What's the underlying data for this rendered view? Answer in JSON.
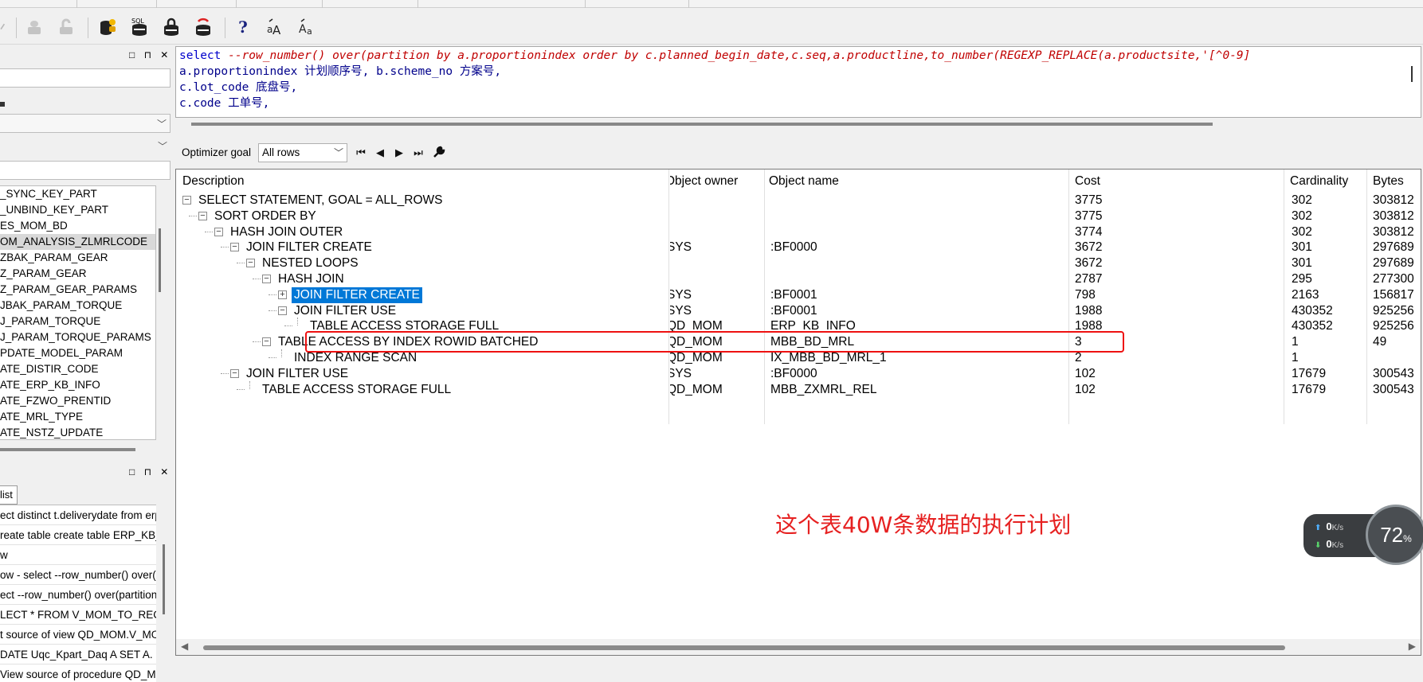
{
  "toolbar": {
    "icons": [
      "disabled-icon",
      "lock-icon",
      "unlock-icon",
      "database-user-icon",
      "sql-database-icon",
      "lock-db-icon",
      "refresh-db-icon",
      "help-icon",
      "font-increase-icon",
      "font-decrease-icon"
    ],
    "help_label": "?"
  },
  "left_panel": {
    "controls": "□ ⊓ ✕",
    "objects": [
      "_SYNC_KEY_PART",
      "_UNBIND_KEY_PART",
      "ES_MOM_BD",
      "OM_ANALYSIS_ZLMRLCODE",
      "ZBAK_PARAM_GEAR",
      "Z_PARAM_GEAR",
      "Z_PARAM_GEAR_PARAMS",
      "JBAK_PARAM_TORQUE",
      "J_PARAM_TORQUE",
      "J_PARAM_TORQUE_PARAMS",
      "PDATE_MODEL_PARAM",
      "ATE_DISTIR_CODE",
      "ATE_ERP_KB_INFO",
      "ATE_FZWO_PRENTID",
      "ATE_MRL_TYPE",
      "ATE_NSTZ_UPDATE"
    ],
    "selected_index": 3
  },
  "history_panel": {
    "controls": "□ ⊓ ✕",
    "tab_label": "list",
    "items": [
      "ect distinct t.deliverydate from erp",
      "reate table create table ERP_KB_",
      "w",
      "ow - select --row_number() over(p",
      "ect --row_number() over(partition b",
      "LECT * FROM V_MOM_TO_REC",
      "t source of view QD_MOM.V_MO",
      "DATE Uqc_Kpart_Daq A SET A.",
      "View source of procedure QD_M"
    ]
  },
  "sql_editor": {
    "line1_kw": "select",
    "line1_comment": " --row_number() over(partition by a.proportionindex order by c.planned_begin_date,c.seq,a.productline,to_number(REGEXP_REPLACE(a.productsite,'[^0-9]",
    "line2": "a.proportionindex 计划顺序号, b.scheme_no 方案号,",
    "line3": "c.lot_code 底盘号,",
    "line4": "c.code 工单号,"
  },
  "plan_toolbar": {
    "optimizer_label": "Optimizer goal",
    "optimizer_value": "All rows",
    "nav_first": "⏮",
    "nav_prev": "◀",
    "nav_next": "▶",
    "nav_last": "⏭"
  },
  "plan_grid": {
    "headers": {
      "description": "Description",
      "owner": "Object owner",
      "name": "Object name",
      "cost": "Cost",
      "cardinality": "Cardinality",
      "bytes": "Bytes"
    },
    "rows": [
      {
        "level": 0,
        "toggle": "−",
        "description": "SELECT STATEMENT, GOAL = ALL_ROWS",
        "owner": "",
        "name": "",
        "cost": "3775",
        "cardinality": "302",
        "bytes": "303812"
      },
      {
        "level": 1,
        "toggle": "−",
        "description": "SORT ORDER BY",
        "owner": "",
        "name": "",
        "cost": "3775",
        "cardinality": "302",
        "bytes": "303812"
      },
      {
        "level": 2,
        "toggle": "−",
        "description": "HASH JOIN OUTER",
        "owner": "",
        "name": "",
        "cost": "3774",
        "cardinality": "302",
        "bytes": "303812"
      },
      {
        "level": 3,
        "toggle": "−",
        "description": "JOIN FILTER CREATE",
        "owner": "SYS",
        "name": ":BF0000",
        "cost": "3672",
        "cardinality": "301",
        "bytes": "297689"
      },
      {
        "level": 4,
        "toggle": "−",
        "description": "NESTED LOOPS",
        "owner": "",
        "name": "",
        "cost": "3672",
        "cardinality": "301",
        "bytes": "297689"
      },
      {
        "level": 5,
        "toggle": "−",
        "description": "HASH JOIN",
        "owner": "",
        "name": "",
        "cost": "2787",
        "cardinality": "295",
        "bytes": "277300"
      },
      {
        "level": 6,
        "toggle": "+",
        "description": "JOIN FILTER CREATE",
        "owner": "SYS",
        "name": ":BF0001",
        "cost": "798",
        "cardinality": "2163",
        "bytes": "156817",
        "highlight": true
      },
      {
        "level": 6,
        "toggle": "−",
        "description": "JOIN FILTER USE",
        "owner": "SYS",
        "name": ":BF0001",
        "cost": "1988",
        "cardinality": "430352",
        "bytes": "925256"
      },
      {
        "level": 7,
        "toggle": "",
        "description": "TABLE ACCESS STORAGE FULL",
        "owner": "QD_MOM",
        "name": "ERP_KB_INFO",
        "cost": "1988",
        "cardinality": "430352",
        "bytes": "925256"
      },
      {
        "level": 5,
        "toggle": "−",
        "description": "TABLE ACCESS BY INDEX ROWID BATCHED",
        "owner": "QD_MOM",
        "name": "MBB_BD_MRL",
        "cost": "3",
        "cardinality": "1",
        "bytes": "49"
      },
      {
        "level": 6,
        "toggle": "",
        "description": "INDEX RANGE SCAN",
        "owner": "QD_MOM",
        "name": "IX_MBB_BD_MRL_1",
        "cost": "2",
        "cardinality": "1",
        "bytes": ""
      },
      {
        "level": 3,
        "toggle": "−",
        "description": "JOIN FILTER USE",
        "owner": "SYS",
        "name": ":BF0000",
        "cost": "102",
        "cardinality": "17679",
        "bytes": "300543"
      },
      {
        "level": 4,
        "toggle": "",
        "description": "TABLE ACCESS STORAGE FULL",
        "owner": "QD_MOM",
        "name": "MBB_ZXMRL_REL",
        "cost": "102",
        "cardinality": "17679",
        "bytes": "300543"
      }
    ],
    "annotation": "这个表40W条数据的执行计划"
  },
  "net_widget": {
    "up_value": "0",
    "down_value": "0",
    "unit": "K/s",
    "cpu_percent": "72",
    "pct_sign": "%"
  },
  "colors": {
    "selection": "#0078d7",
    "annotation": "#e62121",
    "sql_comment": "#c00000",
    "sql_keyword": "#0000cc"
  }
}
